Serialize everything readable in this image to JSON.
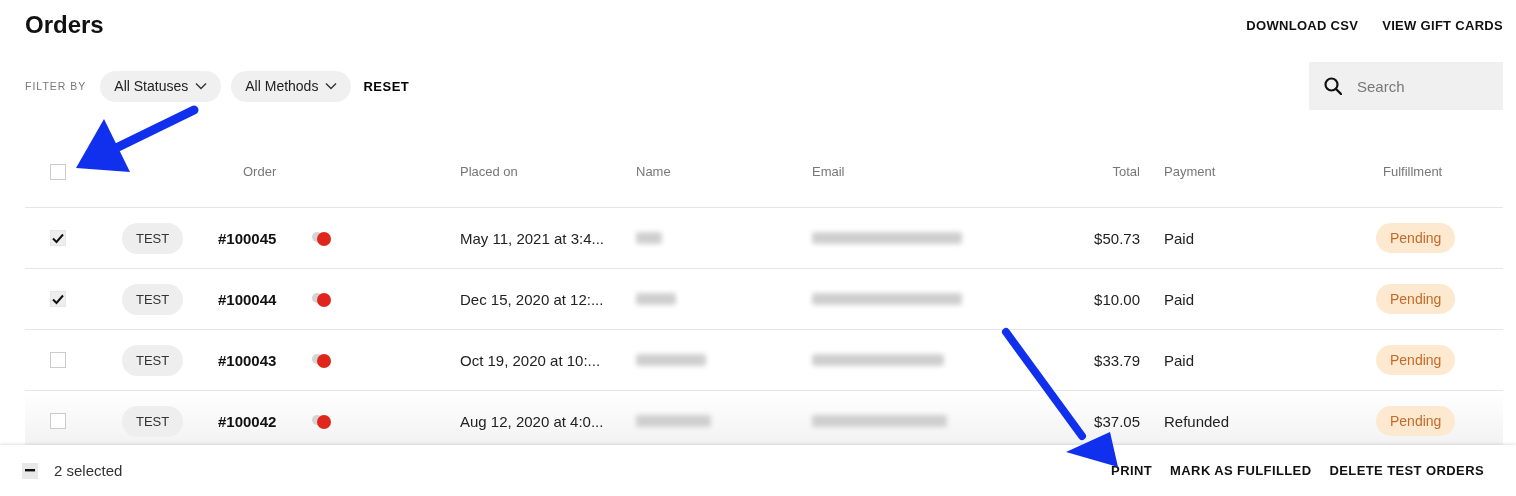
{
  "page": {
    "title": "Orders"
  },
  "header_links": [
    "DOWNLOAD CSV",
    "VIEW GIFT CARDS"
  ],
  "filters": {
    "label": "FILTER BY",
    "dropdowns": [
      "All Statuses",
      "All Methods"
    ],
    "reset": "RESET"
  },
  "search": {
    "placeholder": "Search"
  },
  "table": {
    "select_all_checked": false,
    "columns": [
      "Order",
      "Placed on",
      "Name",
      "Email",
      "Total",
      "Payment",
      "Fulfillment"
    ],
    "rows": [
      {
        "checked": true,
        "badge": "TEST",
        "order": "#100045",
        "placed_on": "May 11, 2021 at 3:4...",
        "total": "$50.73",
        "payment": "Paid",
        "fulfillment": "Pending"
      },
      {
        "checked": true,
        "badge": "TEST",
        "order": "#100044",
        "placed_on": "Dec 15, 2020 at 12:...",
        "total": "$10.00",
        "payment": "Paid",
        "fulfillment": "Pending"
      },
      {
        "checked": false,
        "badge": "TEST",
        "order": "#100043",
        "placed_on": "Oct 19, 2020 at 10:...",
        "total": "$33.79",
        "payment": "Paid",
        "fulfillment": "Pending"
      },
      {
        "checked": false,
        "badge": "TEST",
        "order": "#100042",
        "placed_on": "Aug 12, 2020 at 4:0...",
        "total": "$37.05",
        "payment": "Refunded",
        "fulfillment": "Pending"
      }
    ]
  },
  "bulk_bar": {
    "indeterminate": true,
    "count": "2 selected",
    "actions": [
      "PRINT",
      "MARK AS FULFILLED",
      "DELETE TEST ORDERS"
    ]
  }
}
